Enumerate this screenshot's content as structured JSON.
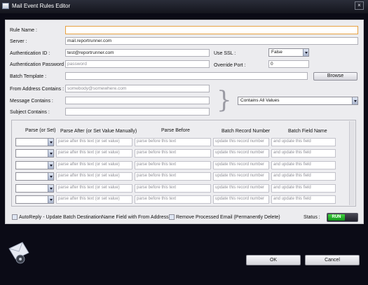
{
  "window": {
    "title": "Mail Event Rules Editor",
    "close_glyph": "×"
  },
  "rule_name": {
    "label": "Rule Name :",
    "value": ""
  },
  "server": {
    "label": "Server :",
    "value": "mail.reportrunner.com"
  },
  "auth_id": {
    "label": "Authentication ID :",
    "value": "test@reportrunner.com"
  },
  "use_ssl": {
    "label": "Use SSL :",
    "value": "False"
  },
  "auth_password": {
    "label": "Authentication Password :",
    "placeholder": "password"
  },
  "override_port": {
    "label": "Override Port :",
    "value": "0"
  },
  "batch_template": {
    "label": "Batch Template :",
    "value": "",
    "browse_label": "Browse"
  },
  "from_address": {
    "label": "From Address Contains :",
    "placeholder": "somebody@somewhere.com"
  },
  "message_contains": {
    "label": "Message Contains :",
    "value": ""
  },
  "subject_contains": {
    "label": "Subject Contains :",
    "value": ""
  },
  "match_mode": {
    "value": "Contains All Values"
  },
  "grid": {
    "headers": [
      "Parse (or Set)",
      "Parse After (or Set Value Manually)",
      "Parse Before",
      "Batch Record Number",
      "Batch Field Name"
    ],
    "rows": [
      {
        "parse_set": "",
        "parse_after": "parse after this text (or set value)",
        "parse_before": "parse before this text",
        "record_number": "update this record number",
        "field_name": "and update this field"
      },
      {
        "parse_set": "",
        "parse_after": "parse after this text (or set value)",
        "parse_before": "parse before this text",
        "record_number": "update this record number",
        "field_name": "and update this field"
      },
      {
        "parse_set": "",
        "parse_after": "parse after this text (or set value)",
        "parse_before": "parse before this text",
        "record_number": "update this record number",
        "field_name": "and update this field"
      },
      {
        "parse_set": "",
        "parse_after": "parse after this text (or set value)",
        "parse_before": "parse before this text",
        "record_number": "update this record number",
        "field_name": "and update this field"
      },
      {
        "parse_set": "",
        "parse_after": "parse after this text (or set value)",
        "parse_before": "parse before this text",
        "record_number": "update this record number",
        "field_name": "and update this field"
      },
      {
        "parse_set": "",
        "parse_after": "parse after this text (or set value)",
        "parse_before": "parse before this text",
        "record_number": "update this record number",
        "field_name": "and update this field"
      }
    ]
  },
  "options": {
    "autoreply_label": "AutoReply - Update Batch DestinationName Field with From Address",
    "autoreply_checked": false,
    "remove_label": "Remove Processed Email (Permanently Delete)",
    "remove_checked": false
  },
  "status": {
    "label": "Status :",
    "toggle_label": "RUN"
  },
  "footer": {
    "ok_label": "OK",
    "cancel_label": "Cancel"
  },
  "colors": {
    "run_green": "#22b72a",
    "focus_border": "#e7a141",
    "background": "#0b0b16"
  }
}
